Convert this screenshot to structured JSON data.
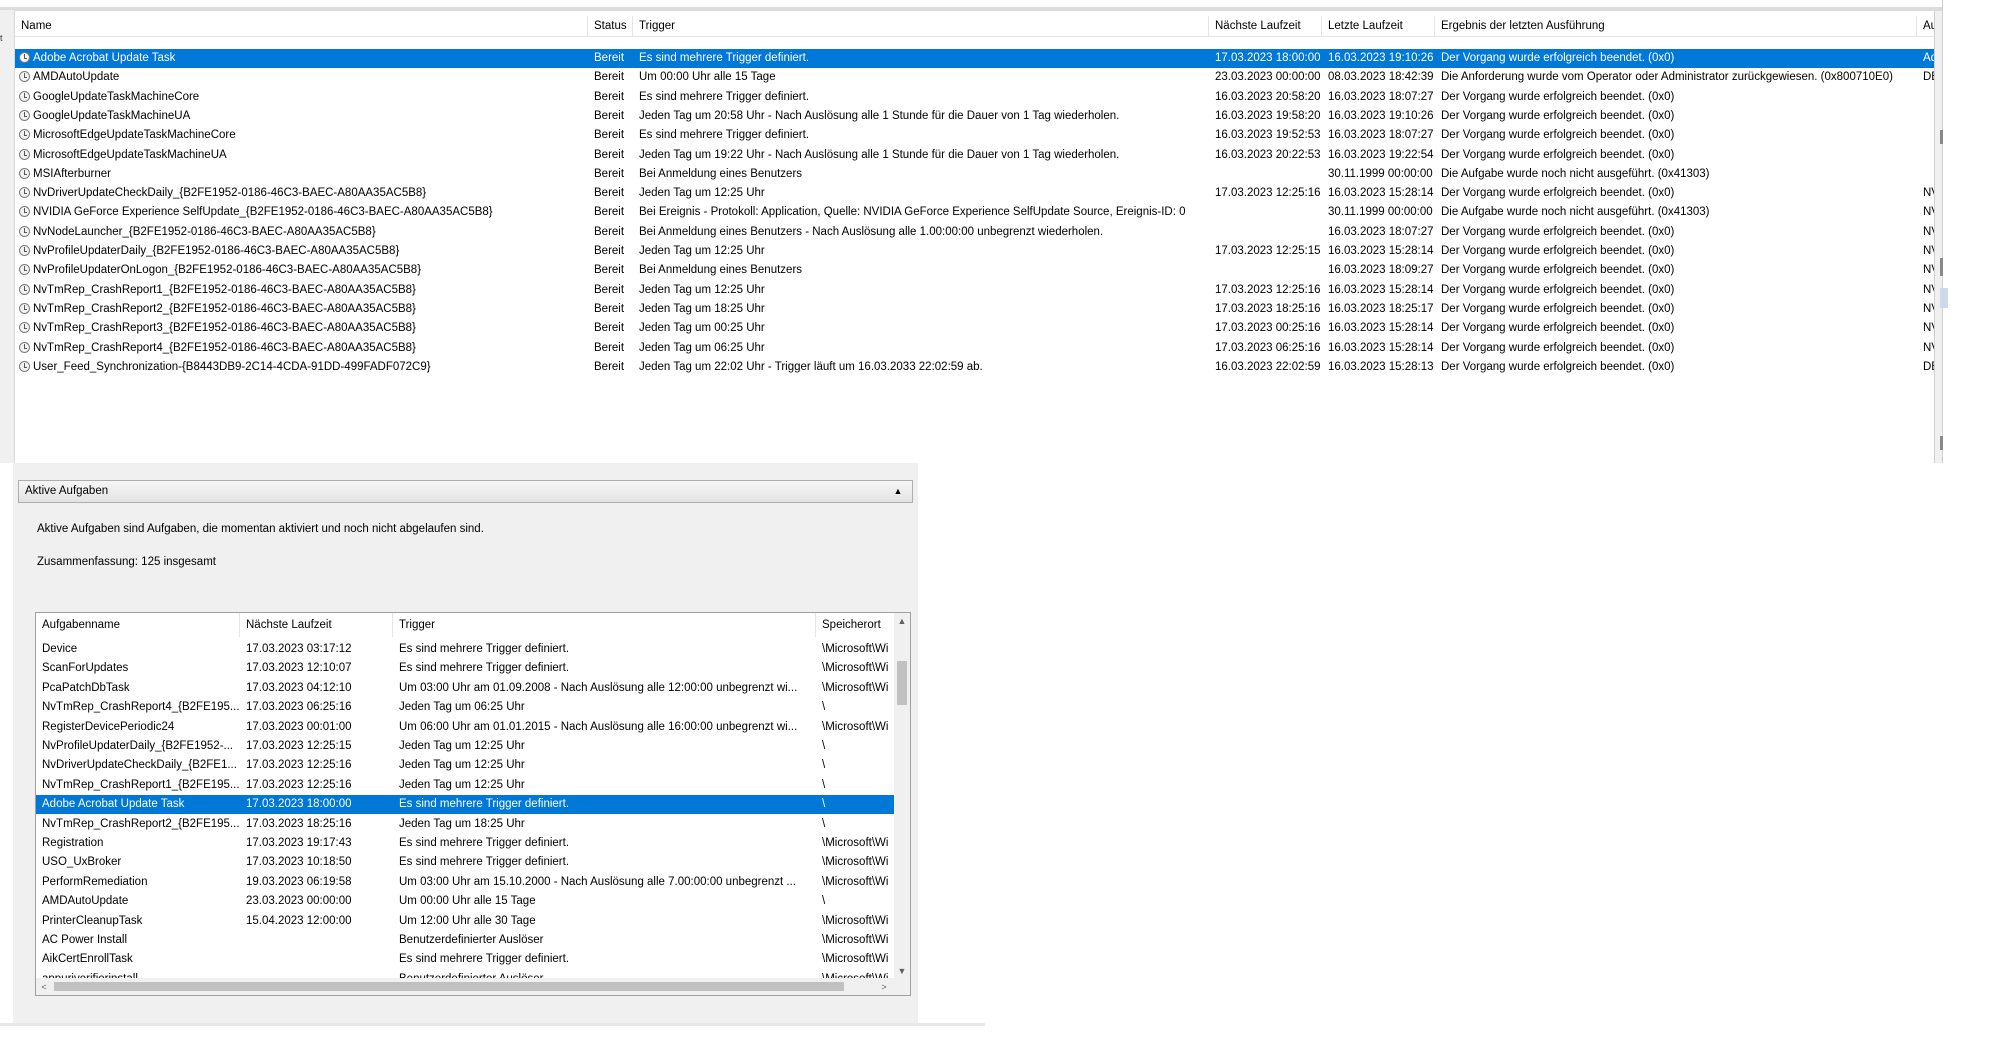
{
  "top_table": {
    "columns": [
      "Name",
      "Status",
      "Trigger",
      "Nächste Laufzeit",
      "Letzte Laufzeit",
      "Ergebnis der letzten Ausführung",
      "Aut"
    ],
    "rows": [
      {
        "name": "Adobe Acrobat Update Task",
        "status": "Bereit",
        "trigger": "Es sind mehrere Trigger definiert.",
        "next": "17.03.2023 18:00:00",
        "last": "16.03.2023 19:10:26",
        "result": "Der Vorgang wurde erfolgreich beendet. (0x0)",
        "author": "Ado",
        "selected": true
      },
      {
        "name": "AMDAutoUpdate",
        "status": "Bereit",
        "trigger": "Um 00:00 Uhr alle 15 Tage",
        "next": "23.03.2023 00:00:00",
        "last": "08.03.2023 18:42:39",
        "result": "Die Anforderung wurde vom Operator oder Administrator zurückgewiesen. (0x800710E0)",
        "author": "DES"
      },
      {
        "name": "GoogleUpdateTaskMachineCore",
        "status": "Bereit",
        "trigger": "Es sind mehrere Trigger definiert.",
        "next": "16.03.2023 20:58:20",
        "last": "16.03.2023 18:07:27",
        "result": "Der Vorgang wurde erfolgreich beendet. (0x0)",
        "author": ""
      },
      {
        "name": "GoogleUpdateTaskMachineUA",
        "status": "Bereit",
        "trigger": "Jeden Tag um 20:58 Uhr - Nach Auslösung alle 1 Stunde für die Dauer von 1 Tag wiederholen.",
        "next": "16.03.2023 19:58:20",
        "last": "16.03.2023 19:10:26",
        "result": "Der Vorgang wurde erfolgreich beendet. (0x0)",
        "author": ""
      },
      {
        "name": "MicrosoftEdgeUpdateTaskMachineCore",
        "status": "Bereit",
        "trigger": "Es sind mehrere Trigger definiert.",
        "next": "16.03.2023 19:52:53",
        "last": "16.03.2023 18:07:27",
        "result": "Der Vorgang wurde erfolgreich beendet. (0x0)",
        "author": ""
      },
      {
        "name": "MicrosoftEdgeUpdateTaskMachineUA",
        "status": "Bereit",
        "trigger": "Jeden Tag um 19:22 Uhr - Nach Auslösung alle 1 Stunde für die Dauer von 1 Tag wiederholen.",
        "next": "16.03.2023 20:22:53",
        "last": "16.03.2023 19:22:54",
        "result": "Der Vorgang wurde erfolgreich beendet. (0x0)",
        "author": ""
      },
      {
        "name": "MSIAfterburner",
        "status": "Bereit",
        "trigger": "Bei Anmeldung eines Benutzers",
        "next": "",
        "last": "30.11.1999 00:00:00",
        "result": "Die Aufgabe wurde noch nicht ausgeführt. (0x41303)",
        "author": ""
      },
      {
        "name": "NvDriverUpdateCheckDaily_{B2FE1952-0186-46C3-BAEC-A80AA35AC5B8}",
        "status": "Bereit",
        "trigger": "Jeden Tag um 12:25 Uhr",
        "next": "17.03.2023 12:25:16",
        "last": "16.03.2023 15:28:14",
        "result": "Der Vorgang wurde erfolgreich beendet. (0x0)",
        "author": "NVI"
      },
      {
        "name": "NVIDIA GeForce Experience SelfUpdate_{B2FE1952-0186-46C3-BAEC-A80AA35AC5B8}",
        "status": "Bereit",
        "trigger": "Bei Ereignis - Protokoll: Application, Quelle: NVIDIA GeForce Experience SelfUpdate Source, Ereignis-ID: 0",
        "next": "",
        "last": "30.11.1999 00:00:00",
        "result": "Die Aufgabe wurde noch nicht ausgeführt. (0x41303)",
        "author": "NVI"
      },
      {
        "name": "NvNodeLauncher_{B2FE1952-0186-46C3-BAEC-A80AA35AC5B8}",
        "status": "Bereit",
        "trigger": "Bei Anmeldung eines Benutzers - Nach Auslösung alle 1.00:00:00 unbegrenzt wiederholen.",
        "next": "",
        "last": "16.03.2023 18:07:27",
        "result": "Der Vorgang wurde erfolgreich beendet. (0x0)",
        "author": "NVI"
      },
      {
        "name": "NvProfileUpdaterDaily_{B2FE1952-0186-46C3-BAEC-A80AA35AC5B8}",
        "status": "Bereit",
        "trigger": "Jeden Tag um 12:25 Uhr",
        "next": "17.03.2023 12:25:15",
        "last": "16.03.2023 15:28:14",
        "result": "Der Vorgang wurde erfolgreich beendet. (0x0)",
        "author": "NVI"
      },
      {
        "name": "NvProfileUpdaterOnLogon_{B2FE1952-0186-46C3-BAEC-A80AA35AC5B8}",
        "status": "Bereit",
        "trigger": "Bei Anmeldung eines Benutzers",
        "next": "",
        "last": "16.03.2023 18:09:27",
        "result": "Der Vorgang wurde erfolgreich beendet. (0x0)",
        "author": "NVI"
      },
      {
        "name": "NvTmRep_CrashReport1_{B2FE1952-0186-46C3-BAEC-A80AA35AC5B8}",
        "status": "Bereit",
        "trigger": "Jeden Tag um 12:25 Uhr",
        "next": "17.03.2023 12:25:16",
        "last": "16.03.2023 15:28:14",
        "result": "Der Vorgang wurde erfolgreich beendet. (0x0)",
        "author": "NVI"
      },
      {
        "name": "NvTmRep_CrashReport2_{B2FE1952-0186-46C3-BAEC-A80AA35AC5B8}",
        "status": "Bereit",
        "trigger": "Jeden Tag um 18:25 Uhr",
        "next": "17.03.2023 18:25:16",
        "last": "16.03.2023 18:25:17",
        "result": "Der Vorgang wurde erfolgreich beendet. (0x0)",
        "author": "NVI"
      },
      {
        "name": "NvTmRep_CrashReport3_{B2FE1952-0186-46C3-BAEC-A80AA35AC5B8}",
        "status": "Bereit",
        "trigger": "Jeden Tag um 00:25 Uhr",
        "next": "17.03.2023 00:25:16",
        "last": "16.03.2023 15:28:14",
        "result": "Der Vorgang wurde erfolgreich beendet. (0x0)",
        "author": "NVI"
      },
      {
        "name": "NvTmRep_CrashReport4_{B2FE1952-0186-46C3-BAEC-A80AA35AC5B8}",
        "status": "Bereit",
        "trigger": "Jeden Tag um 06:25 Uhr",
        "next": "17.03.2023 06:25:16",
        "last": "16.03.2023 15:28:14",
        "result": "Der Vorgang wurde erfolgreich beendet. (0x0)",
        "author": "NVI"
      },
      {
        "name": "User_Feed_Synchronization-{B8443DB9-2C14-4CDA-91DD-499FADF072C9}",
        "status": "Bereit",
        "trigger": "Jeden Tag um 22:02 Uhr - Trigger läuft um 16.03.2033 22:02:59 ab.",
        "next": "16.03.2023 22:02:59",
        "last": "16.03.2023 15:28:13",
        "result": "Der Vorgang wurde erfolgreich beendet. (0x0)",
        "author": "DES"
      }
    ]
  },
  "active_section": {
    "title": "Aktive Aufgaben",
    "collapse_glyph": "▲",
    "description": "Aktive Aufgaben sind Aufgaben, die momentan aktiviert und noch nicht abgelaufen sind.",
    "summary": "Zusammenfassung: 125 insgesamt",
    "columns": [
      "Aufgabenname",
      "Nächste Laufzeit",
      "Trigger",
      "Speicherort"
    ],
    "rows": [
      {
        "name": "Device",
        "next": "17.03.2023 03:17:12",
        "trigger": "Es sind mehrere Trigger definiert.",
        "location": "\\Microsoft\\Wi"
      },
      {
        "name": "ScanForUpdates",
        "next": "17.03.2023 12:10:07",
        "trigger": "Es sind mehrere Trigger definiert.",
        "location": "\\Microsoft\\Wi"
      },
      {
        "name": "PcaPatchDbTask",
        "next": "17.03.2023 04:12:10",
        "trigger": "Um 03:00 Uhr am 01.09.2008 - Nach Auslösung alle 12:00:00 unbegrenzt wi...",
        "location": "\\Microsoft\\Wi"
      },
      {
        "name": "NvTmRep_CrashReport4_{B2FE195...",
        "next": "17.03.2023 06:25:16",
        "trigger": "Jeden Tag um 06:25 Uhr",
        "location": "\\"
      },
      {
        "name": "RegisterDevicePeriodic24",
        "next": "17.03.2023 00:01:00",
        "trigger": "Um 06:00 Uhr am 01.01.2015 - Nach Auslösung alle 16:00:00 unbegrenzt wi...",
        "location": "\\Microsoft\\Wi"
      },
      {
        "name": "NvProfileUpdaterDaily_{B2FE1952-...",
        "next": "17.03.2023 12:25:15",
        "trigger": "Jeden Tag um 12:25 Uhr",
        "location": "\\"
      },
      {
        "name": "NvDriverUpdateCheckDaily_{B2FE1...",
        "next": "17.03.2023 12:25:16",
        "trigger": "Jeden Tag um 12:25 Uhr",
        "location": "\\"
      },
      {
        "name": "NvTmRep_CrashReport1_{B2FE195...",
        "next": "17.03.2023 12:25:16",
        "trigger": "Jeden Tag um 12:25 Uhr",
        "location": "\\"
      },
      {
        "name": "Adobe Acrobat Update Task",
        "next": "17.03.2023 18:00:00",
        "trigger": "Es sind mehrere Trigger definiert.",
        "location": "\\",
        "selected": true
      },
      {
        "name": "NvTmRep_CrashReport2_{B2FE195...",
        "next": "17.03.2023 18:25:16",
        "trigger": "Jeden Tag um 18:25 Uhr",
        "location": "\\"
      },
      {
        "name": "Registration",
        "next": "17.03.2023 19:17:43",
        "trigger": "Es sind mehrere Trigger definiert.",
        "location": "\\Microsoft\\Wi"
      },
      {
        "name": "USO_UxBroker",
        "next": "17.03.2023 10:18:50",
        "trigger": "Es sind mehrere Trigger definiert.",
        "location": "\\Microsoft\\Wi"
      },
      {
        "name": "PerformRemediation",
        "next": "19.03.2023 06:19:58",
        "trigger": "Um 03:00 Uhr am 15.10.2000 - Nach Auslösung alle 7.00:00:00 unbegrenzt ...",
        "location": "\\Microsoft\\Wi"
      },
      {
        "name": "AMDAutoUpdate",
        "next": "23.03.2023 00:00:00",
        "trigger": "Um 00:00 Uhr alle 15 Tage",
        "location": "\\"
      },
      {
        "name": "PrinterCleanupTask",
        "next": "15.04.2023 12:00:00",
        "trigger": "Um 12:00 Uhr alle 30 Tage",
        "location": "\\Microsoft\\Wi"
      },
      {
        "name": "AC Power Install",
        "next": "",
        "trigger": "Benutzerdefinierter Auslöser",
        "location": "\\Microsoft\\Wi"
      },
      {
        "name": "AikCertEnrollTask",
        "next": "",
        "trigger": "Es sind mehrere Trigger definiert.",
        "location": "\\Microsoft\\Wi"
      },
      {
        "name": "appuriverifierinstall",
        "next": "",
        "trigger": "Benutzerdefinierter Auslöser",
        "location": "\\Microsoft\\Wi"
      }
    ],
    "scroll": {
      "up": "▲",
      "down": "▼",
      "left": "<",
      "right": ">"
    }
  },
  "colors": {
    "selection": "#0078d7",
    "panel_bg": "#f0f0f0"
  },
  "icons": {
    "task": "clock-icon"
  }
}
